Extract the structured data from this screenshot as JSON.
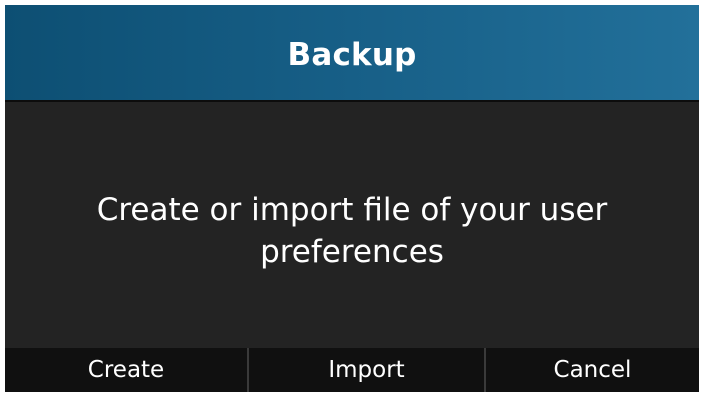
{
  "dialog": {
    "title": "Backup",
    "message": "Create or import file of your user preferences"
  },
  "softkeys": [
    {
      "label": "Create"
    },
    {
      "label": "Import"
    },
    {
      "label": "Cancel"
    }
  ],
  "colors": {
    "title_bar_start": "#0d4f73",
    "title_bar_end": "#22709a",
    "body_background": "#232323",
    "softkey_background": "#101010",
    "text": "#ffffff"
  }
}
